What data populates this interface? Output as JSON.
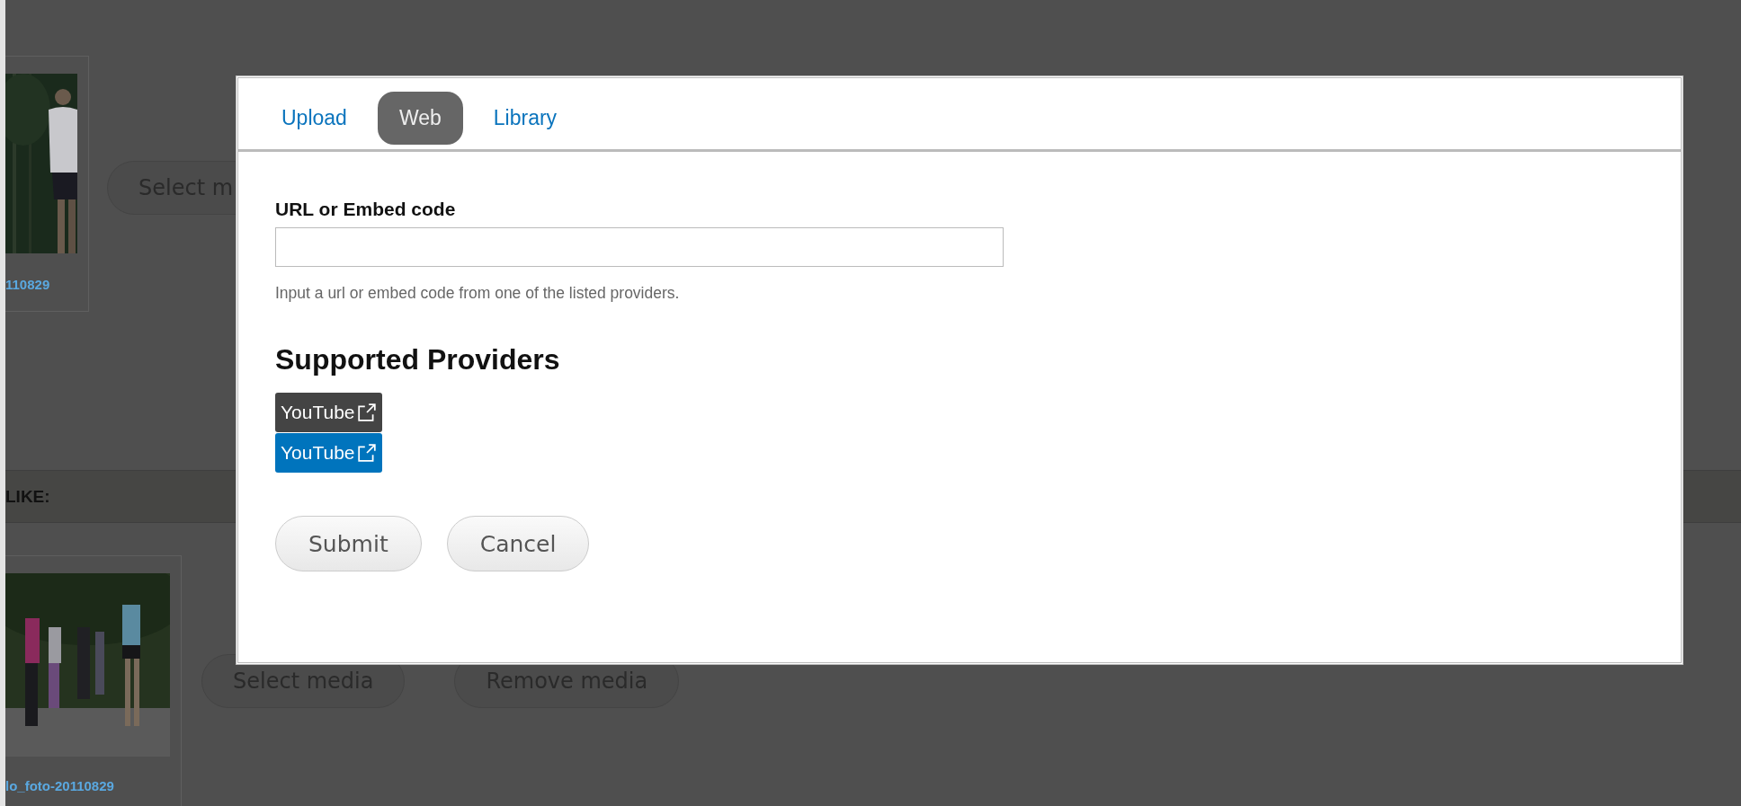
{
  "page": {
    "media_fields": [
      {
        "caption": "110829",
        "buttons": [
          "Select m"
        ]
      },
      {
        "caption": "lo_foto-20110829",
        "buttons": [
          "Select media",
          "Remove media"
        ]
      }
    ],
    "section_title": "LIKE:"
  },
  "dialog": {
    "tabs": [
      {
        "label": "Upload",
        "selected": false
      },
      {
        "label": "Web",
        "selected": true
      },
      {
        "label": "Library",
        "selected": false
      }
    ],
    "field": {
      "label": "URL or Embed code",
      "help": "Input a url or embed code from one of the listed providers."
    },
    "providers_heading": "Supported Providers",
    "providers": [
      {
        "label": "YouTube",
        "color": "#444444"
      },
      {
        "label": "YouTube",
        "color": "#0074bd"
      }
    ],
    "buttons": [
      "Submit",
      "Cancel"
    ]
  }
}
